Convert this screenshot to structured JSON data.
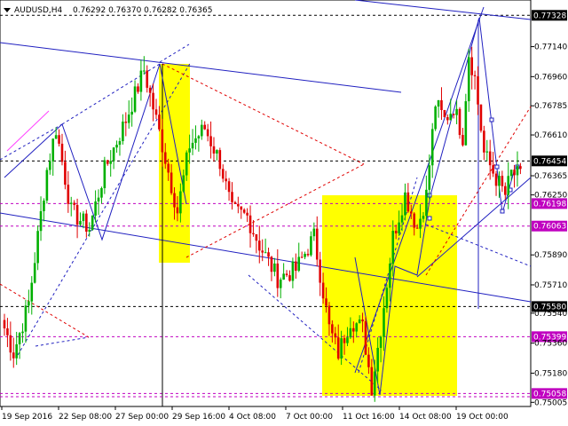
{
  "header": {
    "symbol": "AUDUSD,H4",
    "ohlc": "0.76292 0.76370 0.76282 0.76365"
  },
  "colors": {
    "bull": "#00b000",
    "bear": "#e00000",
    "highlight": "#ffff00",
    "trend": "#2020c0",
    "level": "#c000c0"
  },
  "chart_data": {
    "type": "candlestick",
    "title": "AUDUSD,H4",
    "ylim": [
      0.7498,
      0.7742
    ],
    "price_ticks": [
      {
        "label": "0.77140",
        "value": 0.7714
      },
      {
        "label": "0.76960",
        "value": 0.7696
      },
      {
        "label": "0.76785",
        "value": 0.76785
      },
      {
        "label": "0.76610",
        "value": 0.7661
      },
      {
        "label": "0.76365",
        "value": 0.76365
      },
      {
        "label": "0.76250",
        "value": 0.7625
      },
      {
        "label": "0.75890",
        "value": 0.7589
      },
      {
        "label": "0.75710",
        "value": 0.7571
      },
      {
        "label": "0.75540",
        "value": 0.7554
      },
      {
        "label": "0.75360",
        "value": 0.7536
      },
      {
        "label": "0.75180",
        "value": 0.7518
      },
      {
        "label": "0.75005",
        "value": 0.75005
      }
    ],
    "levels": [
      {
        "label": "0.77328",
        "value": 0.77328,
        "style": "black"
      },
      {
        "label": "0.76454",
        "value": 0.76454,
        "style": "black"
      },
      {
        "label": "0.76198",
        "value": 0.76198,
        "style": "magenta"
      },
      {
        "label": "0.76063",
        "value": 0.76063,
        "style": "magenta"
      },
      {
        "label": "0.75580",
        "value": 0.7558,
        "style": "black"
      },
      {
        "label": "0.75399",
        "value": 0.75399,
        "style": "magenta"
      },
      {
        "label": "0.75058",
        "value": 0.75058,
        "style": "magenta"
      }
    ],
    "time_labels": [
      "19 Sep 2016",
      "22 Sep 08:00",
      "27 Sep 00:00",
      "29 Sep 16:00",
      "4 Oct 08:00",
      "7 Oct 00:00",
      "11 Oct 16:00",
      "14 Oct 08:00",
      "19 Oct 00:00"
    ],
    "waypoints": [
      [
        0,
        0.7545
      ],
      [
        3,
        0.753
      ],
      [
        8,
        0.756
      ],
      [
        14,
        0.764
      ],
      [
        17,
        0.7665
      ],
      [
        22,
        0.7615
      ],
      [
        28,
        0.7605
      ],
      [
        33,
        0.764
      ],
      [
        40,
        0.767
      ],
      [
        46,
        0.77
      ],
      [
        52,
        0.7655
      ],
      [
        57,
        0.7615
      ],
      [
        61,
        0.7655
      ],
      [
        66,
        0.7665
      ],
      [
        71,
        0.7645
      ],
      [
        75,
        0.7615
      ],
      [
        80,
        0.7612
      ],
      [
        84,
        0.7595
      ],
      [
        90,
        0.7575
      ],
      [
        96,
        0.758
      ],
      [
        102,
        0.76
      ],
      [
        107,
        0.7545
      ],
      [
        110,
        0.753
      ],
      [
        114,
        0.755
      ],
      [
        118,
        0.7545
      ],
      [
        121,
        0.751
      ],
      [
        124,
        0.7545
      ],
      [
        128,
        0.76
      ],
      [
        132,
        0.7625
      ],
      [
        136,
        0.7605
      ],
      [
        139,
        0.7625
      ],
      [
        142,
        0.768
      ],
      [
        145,
        0.767
      ],
      [
        148,
        0.7678
      ],
      [
        151,
        0.766
      ],
      [
        153,
        0.771
      ],
      [
        155,
        0.7695
      ],
      [
        158,
        0.765
      ],
      [
        162,
        0.7635
      ],
      [
        165,
        0.7625
      ],
      [
        167,
        0.7638
      ],
      [
        170,
        0.7636
      ]
    ]
  }
}
